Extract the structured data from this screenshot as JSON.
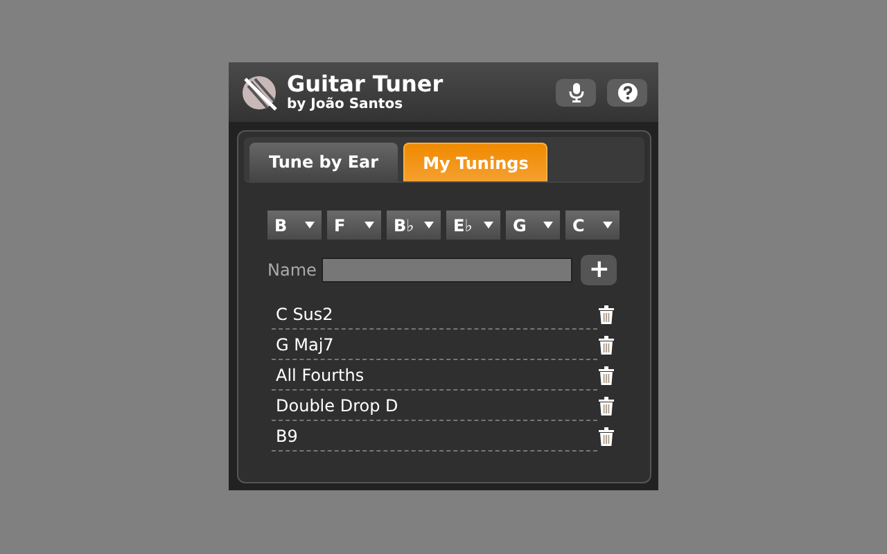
{
  "app": {
    "title": "Guitar Tuner",
    "author": "by João Santos"
  },
  "tabs": [
    {
      "label": "Tune by Ear",
      "selected": false
    },
    {
      "label": "My Tunings",
      "selected": true
    }
  ],
  "strings": [
    "B",
    "F",
    "B♭",
    "E♭",
    "G",
    "C"
  ],
  "name_field": {
    "label": "Name",
    "add": "+"
  },
  "tunings": [
    "C Sus2",
    "G Maj7",
    "All Fourths",
    "Double Drop D",
    "B9"
  ]
}
